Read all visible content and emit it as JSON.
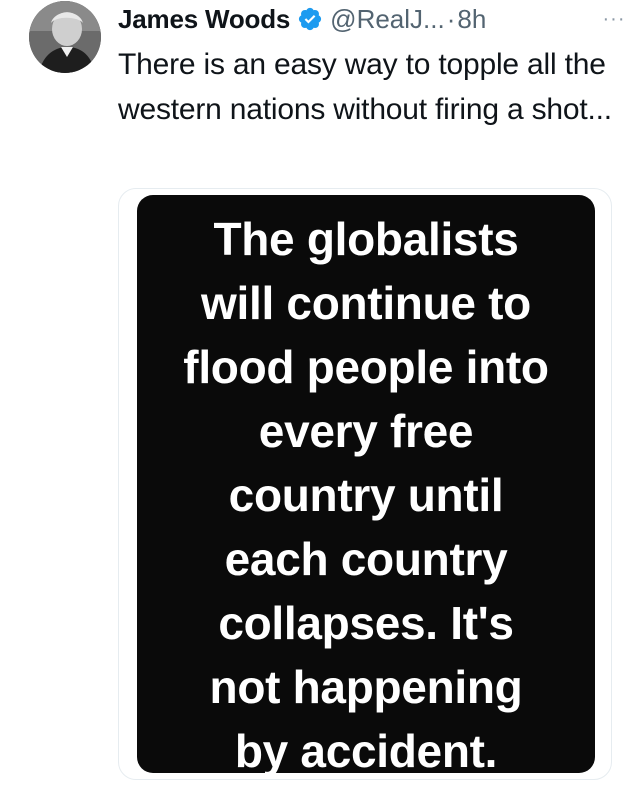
{
  "tweet": {
    "author_name": "James Woods",
    "verified_icon": "verified-badge-icon",
    "handle": "@RealJ...",
    "separator": "·",
    "time": "8h",
    "more_icon": "more-options-icon",
    "more_glyph": "···",
    "text": "There is an easy way to topple all the western nations without firing a shot...",
    "media": {
      "lines": [
        "The globalists",
        "will continue to",
        "flood people into",
        "every free",
        "country until",
        "each country",
        "collapses. It's",
        "not happening",
        "by accident."
      ]
    }
  },
  "colors": {
    "text_primary": "#0f1419",
    "text_secondary": "#536471",
    "verified_blue": "#1d9bf0",
    "media_background": "#0a0a0a",
    "media_text": "#ffffff"
  }
}
